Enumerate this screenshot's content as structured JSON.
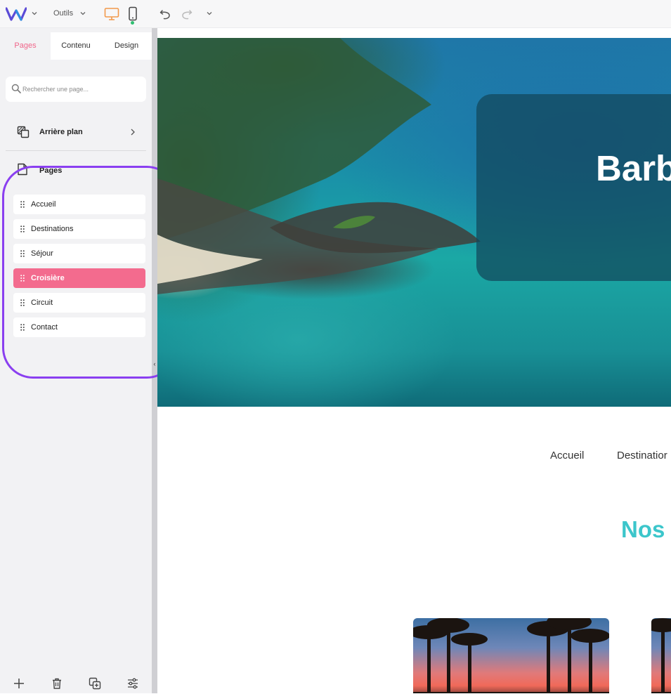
{
  "toolbar": {
    "tools_label": "Outils"
  },
  "panel": {
    "tabs": [
      {
        "label": "Pages",
        "active": true
      },
      {
        "label": "Contenu",
        "active": false
      },
      {
        "label": "Design",
        "active": false
      }
    ],
    "search": {
      "placeholder": "Rechercher une page..."
    },
    "background_link": {
      "label": "Arrière plan",
      "icon": "layers-icon"
    },
    "pages_header": {
      "label": "Pages",
      "icon": "page-icon"
    },
    "pages": [
      {
        "label": "Accueil",
        "selected": false
      },
      {
        "label": "Destinations",
        "selected": false
      },
      {
        "label": "Séjour",
        "selected": false
      },
      {
        "label": "Croisière",
        "selected": true
      },
      {
        "label": "Circuit",
        "selected": false
      },
      {
        "label": "Contact",
        "selected": false
      }
    ],
    "bottom_tools": [
      "add-icon",
      "trash-icon",
      "duplicate-icon",
      "settings-sliders-icon"
    ]
  },
  "preview": {
    "hero_title": "Barb",
    "nav": [
      "Accueil",
      "Destinatior"
    ],
    "section_title": "Nos"
  },
  "colors": {
    "accent_pink": "#f36b8e",
    "accent_orange": "#f2994a",
    "teal_title": "#3cc6cb",
    "highlight_ring": "#8a3ff0"
  }
}
